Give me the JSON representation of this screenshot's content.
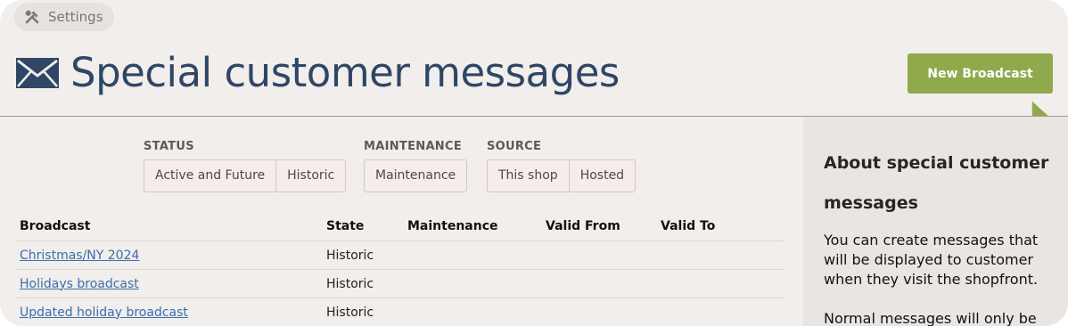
{
  "breadcrumb": {
    "label": "Settings",
    "icon": "tools-icon"
  },
  "header": {
    "title": "Special customer messages",
    "icon": "envelope-icon",
    "new_button": "New Broadcast"
  },
  "filters": [
    {
      "label": "STATUS",
      "options": [
        "Active and Future",
        "Historic"
      ]
    },
    {
      "label": "MAINTENANCE",
      "options": [
        "Maintenance"
      ]
    },
    {
      "label": "SOURCE",
      "options": [
        "This shop",
        "Hosted"
      ]
    }
  ],
  "table": {
    "columns": [
      "Broadcast",
      "State",
      "Maintenance",
      "Valid From",
      "Valid To"
    ],
    "rows": [
      {
        "broadcast": "Christmas/NY 2024",
        "state": "Historic",
        "maintenance": "",
        "valid_from": "",
        "valid_to": ""
      },
      {
        "broadcast": "Holidays broadcast",
        "state": "Historic",
        "maintenance": "",
        "valid_from": "",
        "valid_to": ""
      },
      {
        "broadcast": "Updated holiday broadcast",
        "state": "Historic",
        "maintenance": "",
        "valid_from": "",
        "valid_to": ""
      }
    ]
  },
  "about": {
    "title": "About special customer messages",
    "paragraphs": [
      "You can create messages that will be displayed to customer when they visit the shopfront.",
      "Normal messages will only be"
    ]
  },
  "colors": {
    "accent": "#8fa94c",
    "title": "#2f4666",
    "link": "#3a6fae",
    "panel": "#e9e6e2",
    "background": "#f1eeeb"
  }
}
